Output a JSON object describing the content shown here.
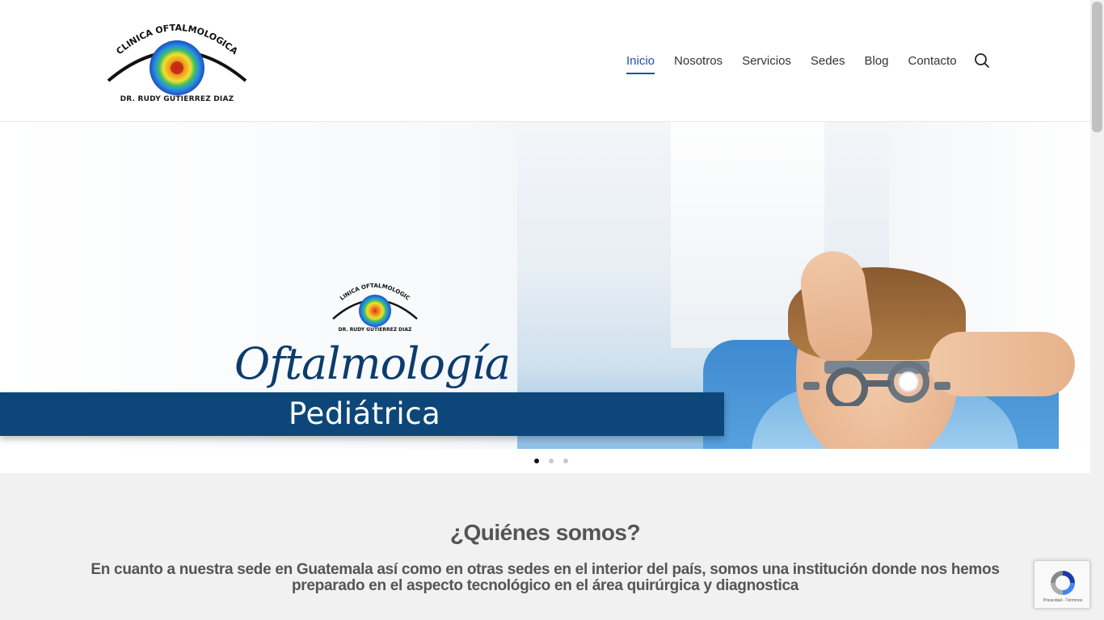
{
  "header": {
    "logo": {
      "arc_text": "CLINICA OFTALMOLOGICA",
      "subtitle": "DR. RUDY GUTIERREZ DIAZ"
    },
    "nav": {
      "items": [
        {
          "label": "Inicio",
          "active": true
        },
        {
          "label": "Nosotros",
          "active": false
        },
        {
          "label": "Servicios",
          "active": false
        },
        {
          "label": "Sedes",
          "active": false
        },
        {
          "label": "Blog",
          "active": false
        },
        {
          "label": "Contacto",
          "active": false
        }
      ],
      "search_icon": "search-icon"
    }
  },
  "hero": {
    "logo": {
      "arc_text": "CLINICA OFTALMOLOGICA",
      "subtitle": "DR. RUDY GUTIERREZ DIAZ"
    },
    "script_title": "Oftalmología",
    "band_text": "Pediátrica",
    "band_color": "#0d4779",
    "slides": {
      "count": 3,
      "active_index": 0
    }
  },
  "about": {
    "title": "¿Quiénes somos?",
    "text": "En cuanto a nuestra sede en Guatemala así como en otras sedes en el interior del país, somos una institución donde nos hemos preparado en el aspecto tecnológico en el área quirúrgica y diagnostica"
  },
  "recaptcha": {
    "label": "Privacidad - Términos"
  },
  "colors": {
    "accent": "#1f4fb3",
    "text_gray": "#555555",
    "section_bg": "#f1f1f1"
  }
}
